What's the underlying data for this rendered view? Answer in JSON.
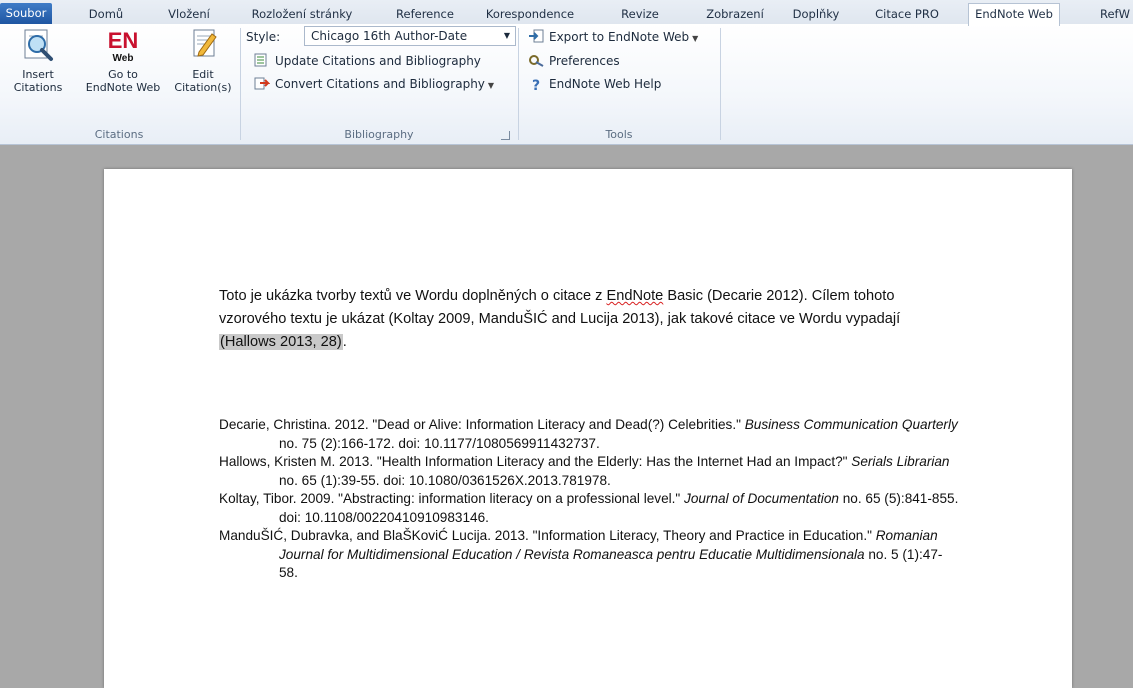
{
  "tabs": [
    {
      "label": "Soubor"
    },
    {
      "label": "Domů"
    },
    {
      "label": "Vložení"
    },
    {
      "label": "Rozložení stránky"
    },
    {
      "label": "Reference"
    },
    {
      "label": "Korespondence"
    },
    {
      "label": "Revize"
    },
    {
      "label": "Zobrazení"
    },
    {
      "label": "Doplňky"
    },
    {
      "label": "Citace PRO"
    },
    {
      "label": "EndNote Web"
    },
    {
      "label": "RefW"
    }
  ],
  "ribbon": {
    "citations": {
      "group_label": "Citations",
      "insert_l1": "Insert",
      "insert_l2": "Citations",
      "goto_l1": "Go to",
      "goto_l2": "EndNote Web",
      "edit_l1": "Edit",
      "edit_l2": "Citation(s)",
      "en_logo_text": "EN",
      "en_logo_sub": "Web"
    },
    "bibliography": {
      "group_label": "Bibliography",
      "style_label": "Style:",
      "style_value": "Chicago 16th Author-Date",
      "update_label": "Update Citations and Bibliography",
      "convert_label": "Convert Citations and Bibliography"
    },
    "tools": {
      "group_label": "Tools",
      "export_label": "Export to EndNote Web",
      "preferences_label": "Preferences",
      "help_label": "EndNote Web Help"
    }
  },
  "document": {
    "para_part1": "Toto je ukázka tvorby textů ve Wordu doplněných o citace z ",
    "para_endnote": "EndNote",
    "para_part2": " Basic (Decarie 2012).  Cílem tohoto vzorového textu je ukázat (Koltay 2009,  ManduŠIĆ and Lucija 2013), jak takové citace ve Wordu vypadají ",
    "para_citation": "(Hallows 2013,  28)",
    "para_end": ".",
    "bibliography": [
      {
        "text": "Decarie, Christina. 2012.  \"Dead or Alive: Information Literacy and Dead(?) Celebrities.\" ",
        "journal": "Business Communication Quarterly",
        "rest": " no. 75 (2):166-172. doi: 10.1177/1080569911432737."
      },
      {
        "text": "Hallows, Kristen M. 2013.  \"Health Information Literacy and the Elderly: Has the Internet Had an Impact?\" ",
        "journal": "Serials Librarian",
        "rest": " no. 65 (1):39-55. doi: 10.1080/0361526X.2013.781978."
      },
      {
        "text": "Koltay, Tibor. 2009.  \"Abstracting: information literacy on a professional level.\" ",
        "journal": "Journal of Documentation",
        "rest": " no. 65 (5):841-855. doi: 10.1108/00220410910983146."
      },
      {
        "text": "ManduŠIĆ, Dubravka, and BlaŠKoviĆ Lucija. 2013.  \"Information Literacy, Theory and Practice in Education.\" ",
        "journal": "Romanian Journal for Multidimensional Education / Revista Romaneasca pentru Educatie Multidimensionala",
        "rest": " no. 5 (1):47-58."
      }
    ]
  },
  "colors": {
    "file_tab": "#2b62ae",
    "ribbon_bg": "#f4f7fb",
    "doc_bg": "#a8a8a8",
    "en_logo": "#c8102e"
  }
}
